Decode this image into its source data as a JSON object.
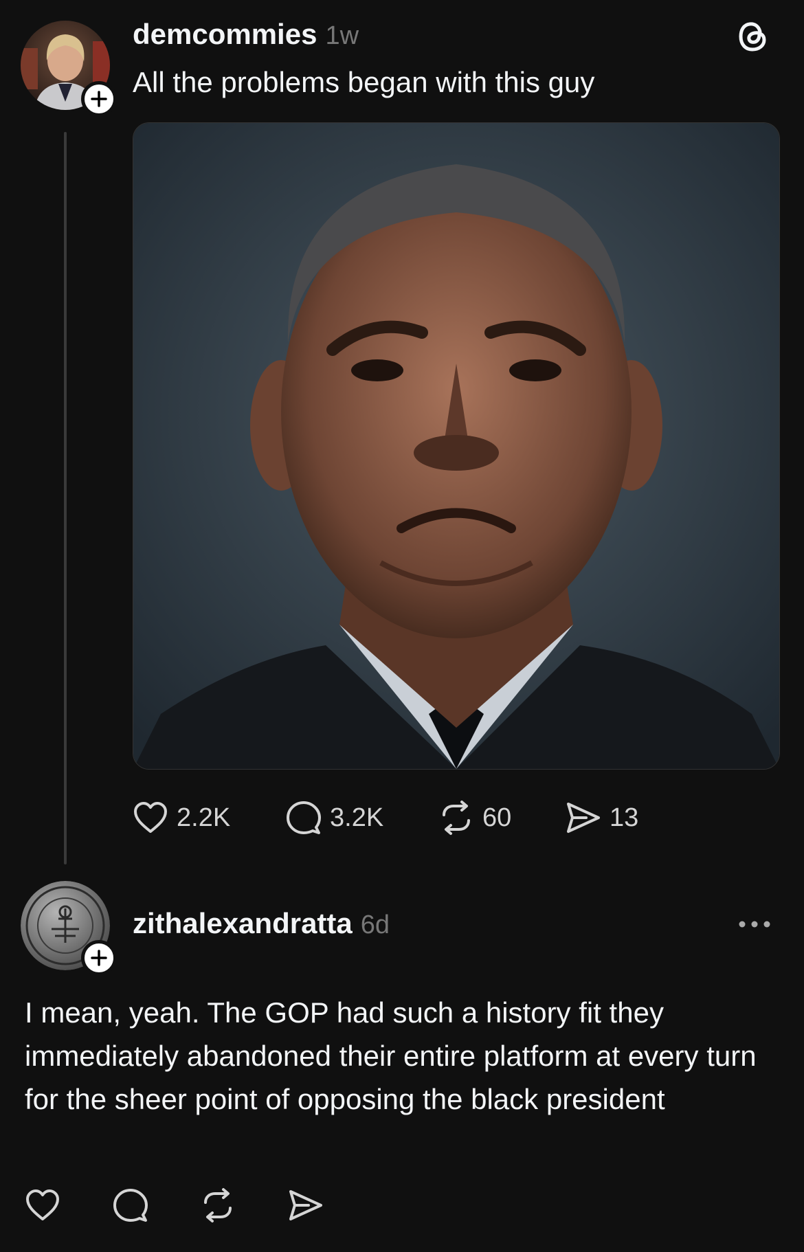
{
  "post": {
    "username": "demcommies",
    "time": "1w",
    "text": "All the problems began with this guy",
    "image_alt": "portrait photo of a frowning man in a dark suit",
    "actions": {
      "likes": "2.2K",
      "replies": "3.2K",
      "reposts": "60",
      "shares": "13"
    }
  },
  "reply": {
    "username": "zithalexandratta",
    "time": "6d",
    "text": "I mean, yeah.  The GOP had such a history fit they immediately abandoned their entire platform at every turn for the sheer point of opposing the black president"
  },
  "icons": {
    "app": "threads-icon",
    "more": "more-icon",
    "like": "heart-icon",
    "reply": "comment-icon",
    "repost": "repost-icon",
    "share": "send-icon",
    "follow": "plus-icon"
  },
  "colors": {
    "background": "#101010",
    "text": "#f3f5f7",
    "muted": "#777777"
  }
}
